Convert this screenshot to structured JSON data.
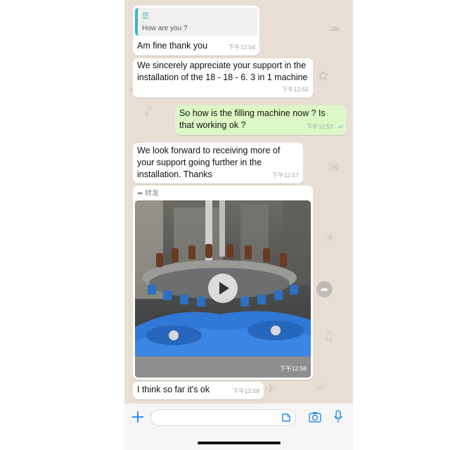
{
  "quoted": {
    "name": "您",
    "text": "How are you ?"
  },
  "messages": [
    {
      "text": "Am fine thank you",
      "time": "下午12:54"
    },
    {
      "text": "We sincerely appreciate your support in the installation of the 18 - 18 - 6. 3 in 1 machine",
      "time": "下午12:55"
    },
    {
      "text": "So how is the filling machine now ? Is that working ok ?",
      "time": "下午12:57",
      "status": "✓✓"
    },
    {
      "text": "We look forward to receiving more of your support going further in the installation. Thanks",
      "time": "下午12:57"
    },
    {
      "forward_label": "转发",
      "video_time": "下午12:58"
    },
    {
      "text": "I think so far it's ok",
      "time": "下午12:58"
    }
  ],
  "icons": {
    "plus": "plus-icon",
    "sticker": "sticker-icon",
    "camera": "camera-icon",
    "mic": "microphone-icon",
    "forward": "forward-icon",
    "play": "play-icon",
    "read_receipt": "double-check-icon"
  },
  "colors": {
    "accent": "#2f8ee8",
    "outgoing_bubble": "#dcf8c6",
    "incoming_bubble": "#ffffff",
    "wallpaper": "#e7dfd4",
    "quote_bar": "#35b8c4",
    "read_tick": "#4fb6ec"
  }
}
